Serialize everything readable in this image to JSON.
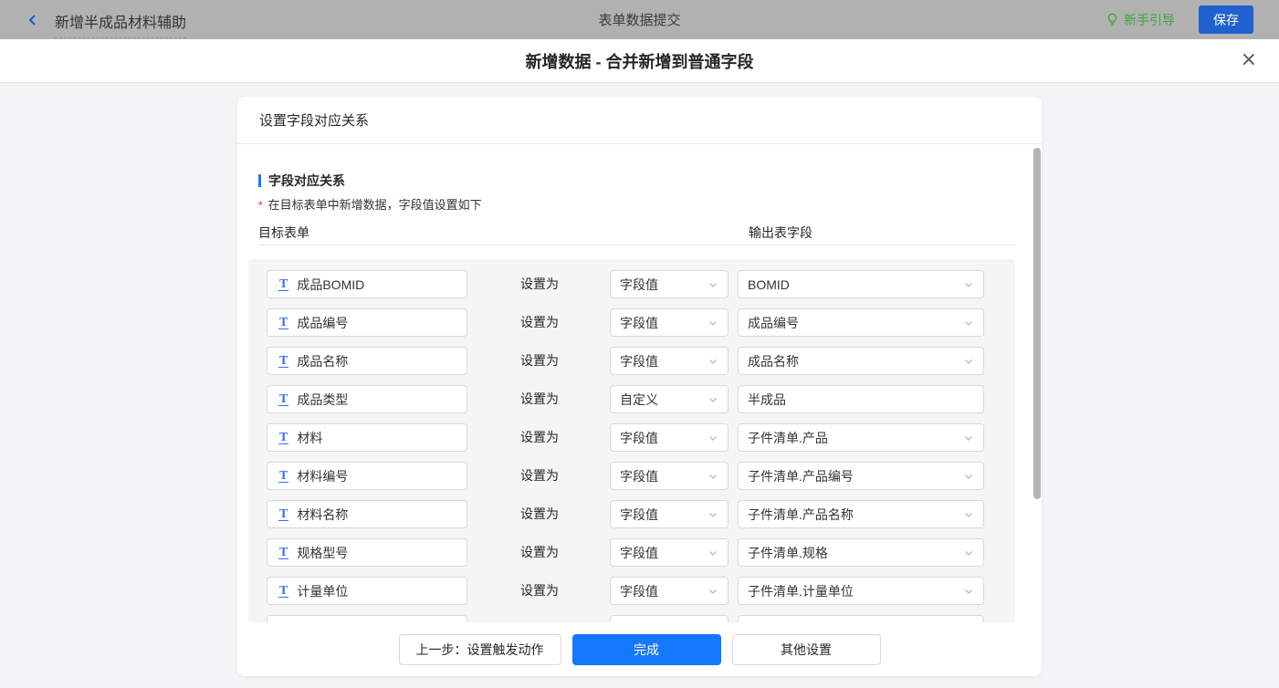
{
  "topbar": {
    "back_label": "新增半成品材料辅助",
    "center_title": "表单数据提交",
    "guide_label": "新手引导",
    "save_label": "保存"
  },
  "modal": {
    "title": "新增数据 - 合并新增到普通字段",
    "close_glyph": "×"
  },
  "card": {
    "header": "设置字段对应关系",
    "section_title": "字段对应关系",
    "note_mark": "*",
    "note": "在目标表单中新增数据，字段值设置如下",
    "col_left": "目标表单",
    "col_right": "输出表字段",
    "set_as_label": "设置为"
  },
  "rows": [
    {
      "field": "成品BOMID",
      "mode": "字段值",
      "value": "BOMID",
      "custom": false,
      "partial": false
    },
    {
      "field": "成品编号",
      "mode": "字段值",
      "value": "成品编号",
      "custom": false,
      "partial": false
    },
    {
      "field": "成品名称",
      "mode": "字段值",
      "value": "成品名称",
      "custom": false,
      "partial": false
    },
    {
      "field": "成品类型",
      "mode": "自定义",
      "value": "半成品",
      "custom": true,
      "partial": false
    },
    {
      "field": "材料",
      "mode": "字段值",
      "value": "子件清单.产品",
      "custom": false,
      "partial": false
    },
    {
      "field": "材料编号",
      "mode": "字段值",
      "value": "子件清单.产品编号",
      "custom": false,
      "partial": false
    },
    {
      "field": "材料名称",
      "mode": "字段值",
      "value": "子件清单.产品名称",
      "custom": false,
      "partial": false
    },
    {
      "field": "规格型号",
      "mode": "字段值",
      "value": "子件清单.规格",
      "custom": false,
      "partial": false
    },
    {
      "field": "计量单位",
      "mode": "字段值",
      "value": "子件清单.计量单位",
      "custom": false,
      "partial": false
    },
    {
      "field": "",
      "mode": "",
      "value": "",
      "custom": true,
      "partial": true
    }
  ],
  "footer": {
    "prev_label": "上一步：设置触发动作",
    "done_label": "完成",
    "other_label": "其他设置"
  },
  "colors": {
    "accent_blue": "#1677ff",
    "save_button_blue": "#2161cf",
    "guide_green": "#3ea43a",
    "field_icon_blue": "#3b6ef5",
    "note_red": "#f5222d",
    "topbar_dimmed_gray": "#b1b1b1",
    "page_background": "#f4f4f6",
    "scroll_area_background": "#f5f5f6"
  }
}
